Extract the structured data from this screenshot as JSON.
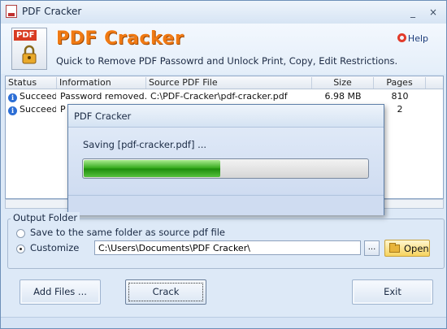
{
  "window": {
    "title": "PDF Cracker",
    "controls": [
      "_",
      "×"
    ]
  },
  "header": {
    "app_name": "PDF Cracker",
    "tagline": "Quick to Remove PDF  Passowrd and Unlock Print, Copy, Edit Restrictions.",
    "help_label": "Help",
    "logo_label": "PDF"
  },
  "table": {
    "columns": [
      "Status",
      "Information",
      "Source PDF File",
      "Size",
      "Pages"
    ],
    "rows": [
      {
        "status": "Succeed",
        "info": "Password removed.",
        "file": "C:\\PDF-Cracker\\pdf-cracker.pdf",
        "size": "6.98 MB",
        "pages": "810"
      },
      {
        "status": "Succeed",
        "info": "P",
        "file": "",
        "size": "",
        "pages": "2"
      }
    ]
  },
  "dialog": {
    "title": "PDF Cracker",
    "message": "Saving [pdf-cracker.pdf] ...",
    "progress_fraction": 0.48
  },
  "output": {
    "group_label": "Output Folder",
    "same_folder_label": "Save to the same folder as source pdf file",
    "customize_label": "Customize",
    "path_value": "C:\\Users\\Documents\\PDF Cracker\\",
    "browse_label": "...",
    "open_label": "Open",
    "selected": "customize"
  },
  "buttons": {
    "add_files": "Add Files ...",
    "crack": "Crack",
    "exit": "Exit"
  },
  "colors": {
    "accent_orange": "#f07a14",
    "progress_green": "#2ea616",
    "info_blue": "#2c6ed5"
  }
}
